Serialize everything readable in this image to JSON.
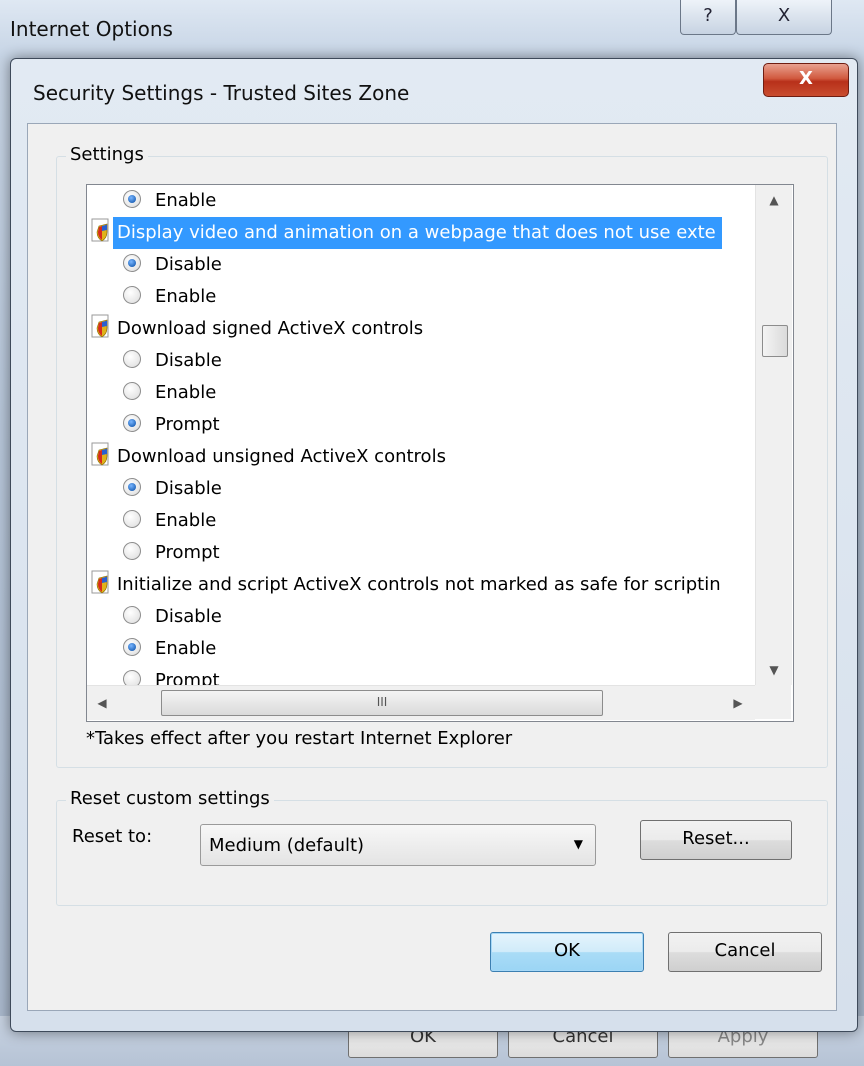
{
  "parent": {
    "title": "Internet Options",
    "help_glyph": "?",
    "close_glyph": "X",
    "buttons": {
      "ok": "OK",
      "cancel": "Cancel",
      "apply": "Apply"
    }
  },
  "dialog": {
    "title": "Security Settings - Trusted Sites Zone",
    "close_glyph": "X",
    "settings_label": "Settings",
    "rows": [
      {
        "kind": "option",
        "label": "Enable",
        "checked": true
      },
      {
        "kind": "category",
        "label": "Display video and animation on a webpage that does not use exte",
        "selected": true
      },
      {
        "kind": "option",
        "label": "Disable",
        "checked": true
      },
      {
        "kind": "option",
        "label": "Enable",
        "checked": false
      },
      {
        "kind": "category",
        "label": "Download signed ActiveX controls",
        "selected": false
      },
      {
        "kind": "option",
        "label": "Disable",
        "checked": false
      },
      {
        "kind": "option",
        "label": "Enable",
        "checked": false
      },
      {
        "kind": "option",
        "label": "Prompt",
        "checked": true
      },
      {
        "kind": "category",
        "label": "Download unsigned ActiveX controls",
        "selected": false
      },
      {
        "kind": "option",
        "label": "Disable",
        "checked": true
      },
      {
        "kind": "option",
        "label": "Enable",
        "checked": false
      },
      {
        "kind": "option",
        "label": "Prompt",
        "checked": false
      },
      {
        "kind": "category",
        "label": "Initialize and script ActiveX controls not marked as safe for scriptin",
        "selected": false
      },
      {
        "kind": "option",
        "label": "Disable",
        "checked": false
      },
      {
        "kind": "option",
        "label": "Enable",
        "checked": true
      },
      {
        "kind": "option",
        "label": "Prompt",
        "checked": false
      }
    ],
    "scroll": {
      "up": "▲",
      "down": "▼",
      "left": "◀",
      "right": "▶",
      "grip": "III"
    },
    "note": "*Takes effect after you restart Internet Explorer",
    "reset_label": "Reset custom settings",
    "reset_to_label": "Reset to:",
    "reset_select": {
      "value": "Medium (default)",
      "arrow": "▼"
    },
    "reset_button": "Reset...",
    "ok_button": "OK",
    "cancel_button": "Cancel"
  }
}
